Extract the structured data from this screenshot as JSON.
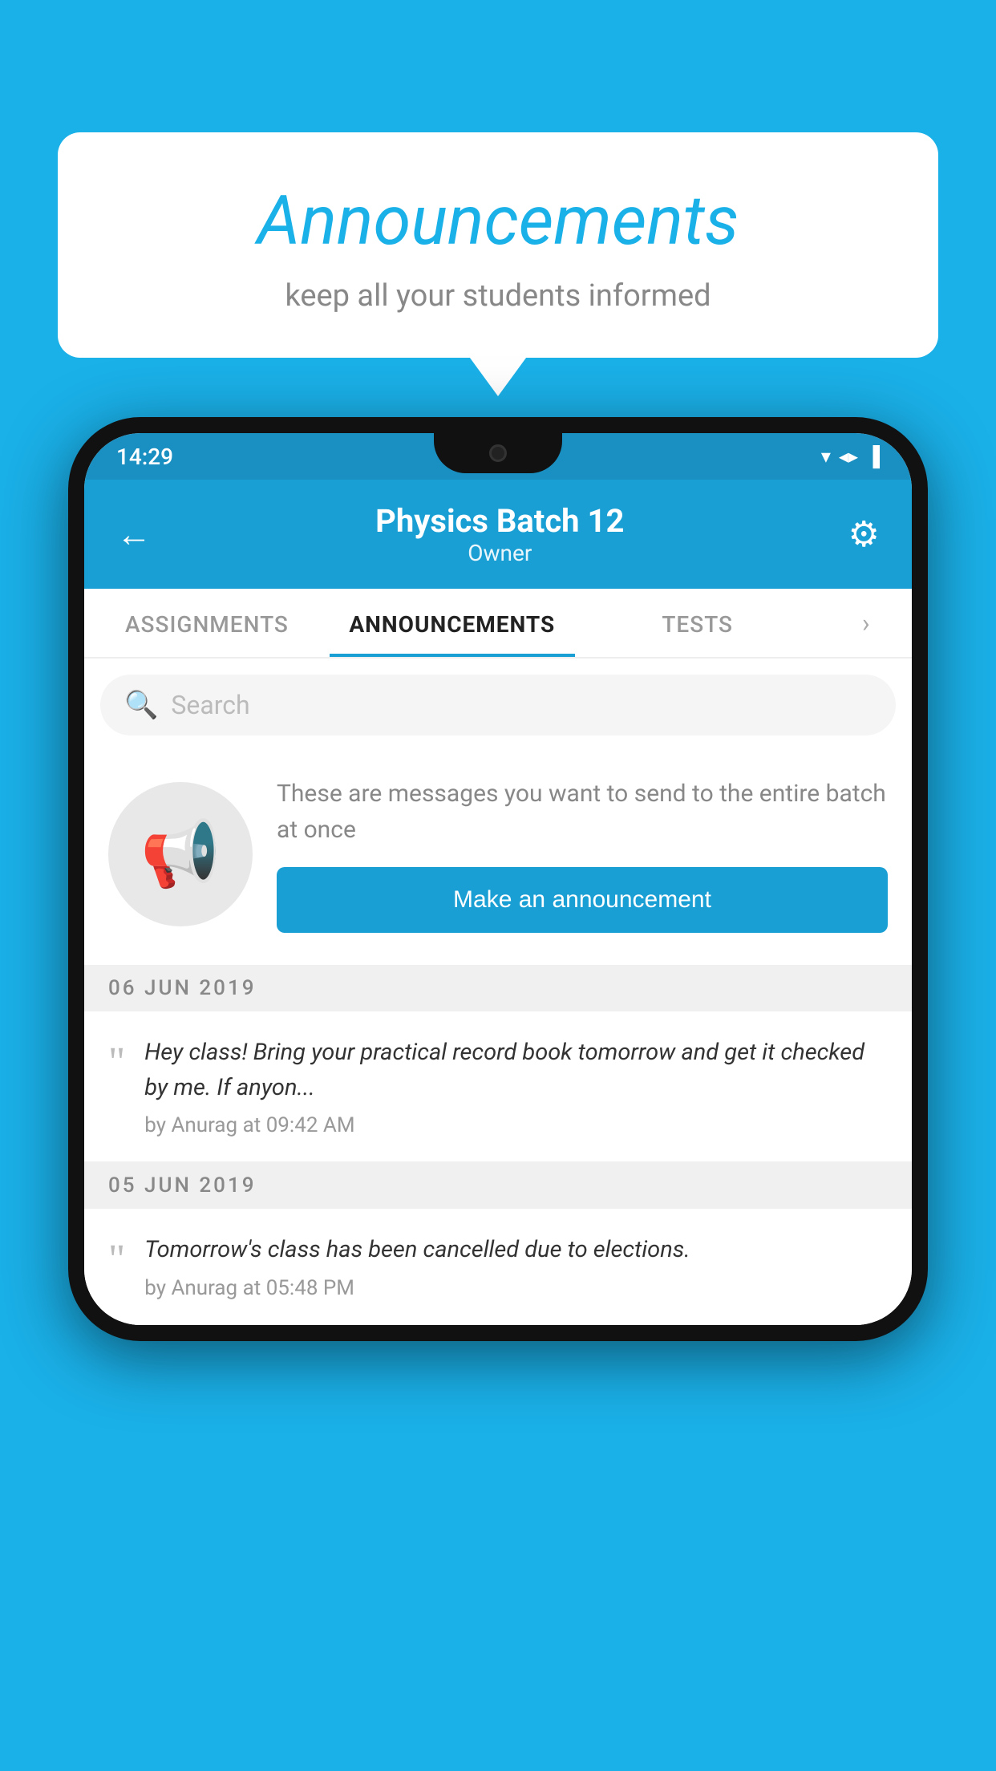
{
  "background_color": "#1ab0e8",
  "speech_bubble": {
    "title": "Announcements",
    "subtitle": "keep all your students informed"
  },
  "status_bar": {
    "time": "14:29",
    "icons": [
      "▼",
      "◀",
      "▐"
    ]
  },
  "header": {
    "title": "Physics Batch 12",
    "subtitle": "Owner",
    "back_label": "←",
    "gear_label": "⚙"
  },
  "tabs": [
    {
      "label": "ASSIGNMENTS",
      "active": false
    },
    {
      "label": "ANNOUNCEMENTS",
      "active": true
    },
    {
      "label": "TESTS",
      "active": false
    }
  ],
  "search": {
    "placeholder": "Search"
  },
  "promo": {
    "description": "These are messages you want to send to the entire batch at once",
    "button_label": "Make an announcement"
  },
  "announcements": [
    {
      "date": "06  JUN  2019",
      "text": "Hey class! Bring your practical record book tomorrow and get it checked by me. If anyon...",
      "author": "by Anurag at 09:42 AM"
    },
    {
      "date": "05  JUN  2019",
      "text": "Tomorrow's class has been cancelled due to elections.",
      "author": "by Anurag at 05:48 PM"
    }
  ]
}
